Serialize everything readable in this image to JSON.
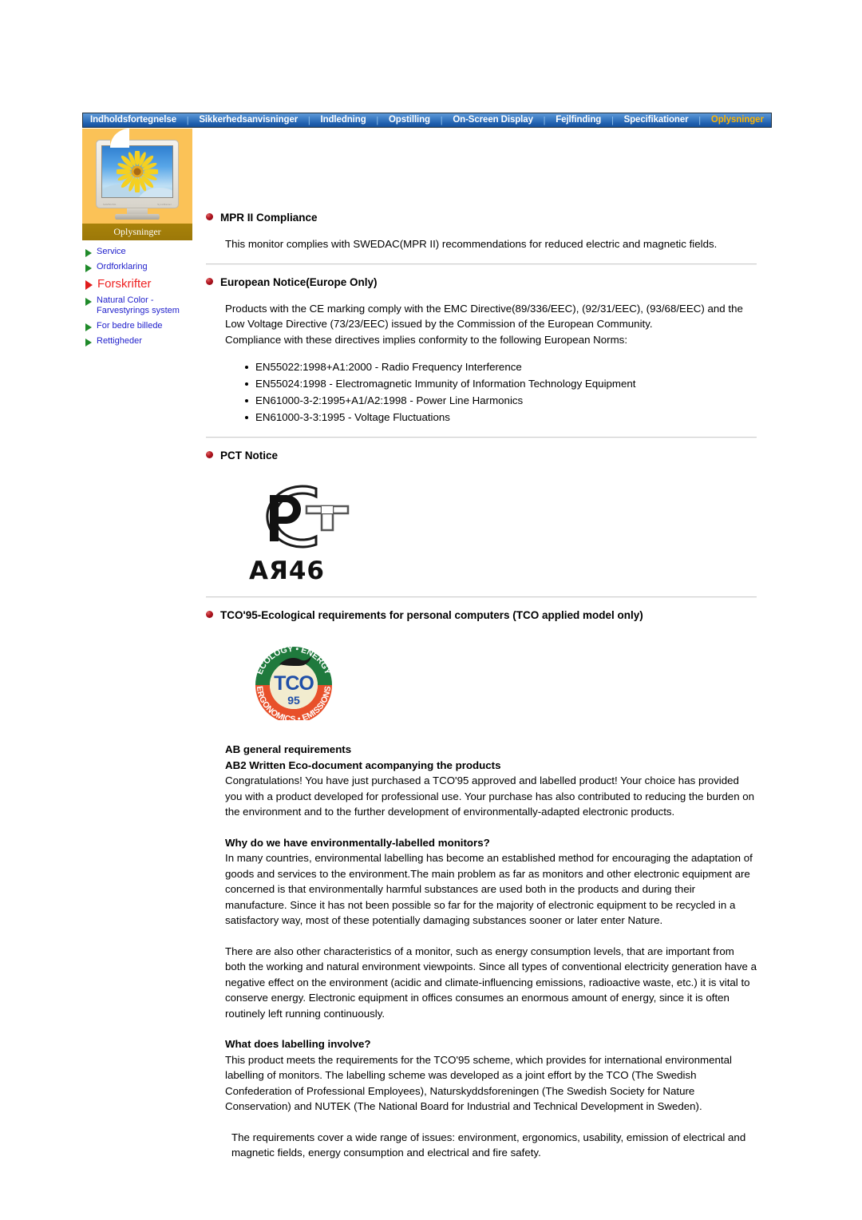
{
  "navbar": {
    "items": [
      {
        "label": "Indholdsfortegnelse",
        "active": false
      },
      {
        "label": "Sikkerhedsanvisninger",
        "active": false
      },
      {
        "label": "Indledning",
        "active": false
      },
      {
        "label": "Opstilling",
        "active": false
      },
      {
        "label": "On-Screen Display",
        "active": false
      },
      {
        "label": "Fejlfinding",
        "active": false
      },
      {
        "label": "Specifikationer",
        "active": false
      },
      {
        "label": "Oplysninger",
        "active": true
      }
    ],
    "separator": "|",
    "active_color": "#ffb400",
    "text_color": "#ffffff"
  },
  "sidebar": {
    "caption": "Oplysninger",
    "panel_color": "#fbc257",
    "caption_bar_color": "#a8820a",
    "thumbnail": "crt-monitor-sunflower-image",
    "links": [
      {
        "label": "Service",
        "active": false
      },
      {
        "label": "Ordforklaring",
        "active": false
      },
      {
        "label": "Forskrifter",
        "active": true
      },
      {
        "label": "Natural Color - Farvestyrings system",
        "active": false
      },
      {
        "label": "For bedre billede",
        "active": false
      },
      {
        "label": "Rettigheder",
        "active": false
      }
    ],
    "link_color": "#2222cc",
    "active_link_color": "#ee2222",
    "marker_color": "#1f8a2a",
    "active_marker_color": "#e01b1b"
  },
  "content": {
    "mpr": {
      "heading": "MPR II Compliance",
      "paragraph": "This monitor complies with SWEDAC(MPR II) recommendations for reduced electric and magnetic fields."
    },
    "european": {
      "heading": "European Notice(Europe Only)",
      "paragraph1": "Products with the CE marking comply with the EMC Directive(89/336/EEC), (92/31/EEC), (93/68/EEC) and the Low Voltage Directive (73/23/EEC) issued by the Commission of the European Community.",
      "paragraph2": "Compliance with these directives implies conformity to the following European Norms:",
      "norms": [
        "EN55022:1998+A1:2000 - Radio Frequency Interference",
        "EN55024:1998 - Electromagnetic Immunity of Information Technology Equipment",
        "EN61000-3-2:1995+A1/A2:1998 - Power Line Harmonics",
        "EN61000-3-3:1995 - Voltage Fluctuations"
      ]
    },
    "pct": {
      "heading": "PCT Notice",
      "mark_code": "АЯ46",
      "mark_label": "pct-certification-mark"
    },
    "tco": {
      "heading": "TCO'95-Ecological requirements for personal computers (TCO applied model only)",
      "logo": {
        "top_arc_text": "ECOLOGY • ENERGY",
        "bottom_arc_text": "ERGONOMICS • EMISSIONS",
        "center_text": "TCO",
        "year_text": "95",
        "top_arc_color": "#1f7a3d",
        "bottom_arc_color": "#e8502a",
        "center_color": "#1f4fa8"
      },
      "sub1": "AB general requirements",
      "sub2": "AB2 Written Eco-document acompanying the products",
      "p1": "Congratulations! You have just purchased a TCO'95 approved and labelled product! Your choice has provided you with a product developed for professional use. Your purchase has also contributed to reducing the burden on the environment and to the further development of environmentally-adapted electronic products.",
      "sub3": "Why do we have environmentally-labelled monitors?",
      "p2": "In many countries, environmental labelling has become an established method for encouraging the adaptation of goods and services to the environment.The main problem as far as monitors and other electronic equipment are concerned is that environmentally harmful substances are used both in the products and during their manufacture. Since it has not been possible so far for the majority of electronic equipment to be recycled in a satisfactory way, most of these potentially damaging substances sooner or later enter Nature.",
      "p3": "There are also other characteristics of a monitor, such as energy consumption levels, that are important from both the working and natural environment viewpoints. Since all types of conventional electricity generation have a negative effect on the environment (acidic and climate-influencing emissions, radioactive waste, etc.) it is vital to conserve energy. Electronic equipment in offices consumes an enormous amount of energy, since it is often routinely left running continuously.",
      "sub4": "What does labelling involve?",
      "p4": "This product meets the requirements for the TCO'95 scheme, which provides for international environmental labelling of monitors. The labelling scheme was developed as a joint effort by the TCO (The Swedish Confederation of Professional Employees), Naturskyddsforeningen (The Swedish Society for Nature Conservation) and NUTEK (The National Board for Industrial and Technical Development in Sweden).",
      "p5": "The requirements cover a wide range of issues: environment, ergonomics, usability, emission of electrical and magnetic fields, energy consumption and electrical and fire safety."
    }
  }
}
